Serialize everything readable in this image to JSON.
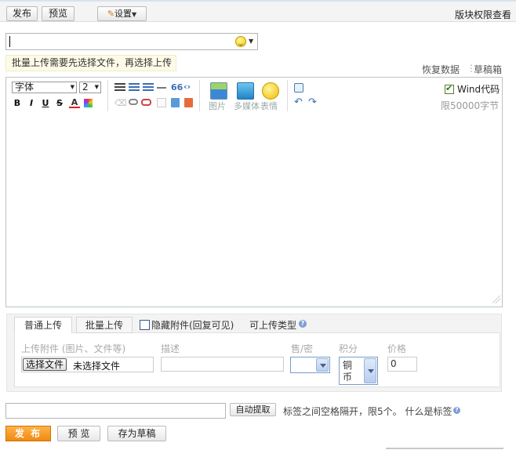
{
  "topbar": {
    "publish": "发布",
    "preview": "预览",
    "settings": "设置",
    "board_permissions": "版块权限查看"
  },
  "title": {
    "value": "",
    "emoji_icon": "smiley-icon"
  },
  "hint": "批量上传需要先选择文件，再选择上传",
  "links": {
    "restore": "恢复数据",
    "separator": "⋮",
    "drafts": "草稿箱"
  },
  "editor": {
    "font": "字体",
    "size": "2",
    "format": {
      "bold": "B",
      "italic": "I",
      "underline": "U",
      "strike": "S",
      "color": "A"
    },
    "insert": {
      "image": "图片",
      "media": "多媒体",
      "emoticon": "表情"
    },
    "wind_code": "Wind代码",
    "wind_checked": true,
    "limit": "限50000字节",
    "body": ""
  },
  "attachments": {
    "tab_normal": "普通上传",
    "tab_batch": "批量上传",
    "hidden_label": "隐藏附件(回复可见)",
    "hidden_checked": false,
    "types_label": "可上传类型",
    "help_glyph": "?",
    "columns": {
      "file": "上传附件 (图片、文件等)",
      "desc": "描述",
      "sale": "售/密",
      "credit": "积分",
      "price": "价格"
    },
    "choose_file": "选择文件",
    "no_file": "未选择文件",
    "description": "",
    "sale_value": "",
    "credit_value": "铜币",
    "price_value": "0"
  },
  "tags": {
    "value": "",
    "auto_extract": "自动提取",
    "hint": "标签之间空格隔开，限5个。 什么是标签"
  },
  "bottom": {
    "publish": "发 布",
    "preview": "预 览",
    "save_draft": "存为草稿"
  },
  "colors": {
    "publish_orange": "#f08a10",
    "hint_bg": "#fdfbe7",
    "editor_border": "#b8c4cd",
    "panel_bg": "#f3f3f3"
  }
}
